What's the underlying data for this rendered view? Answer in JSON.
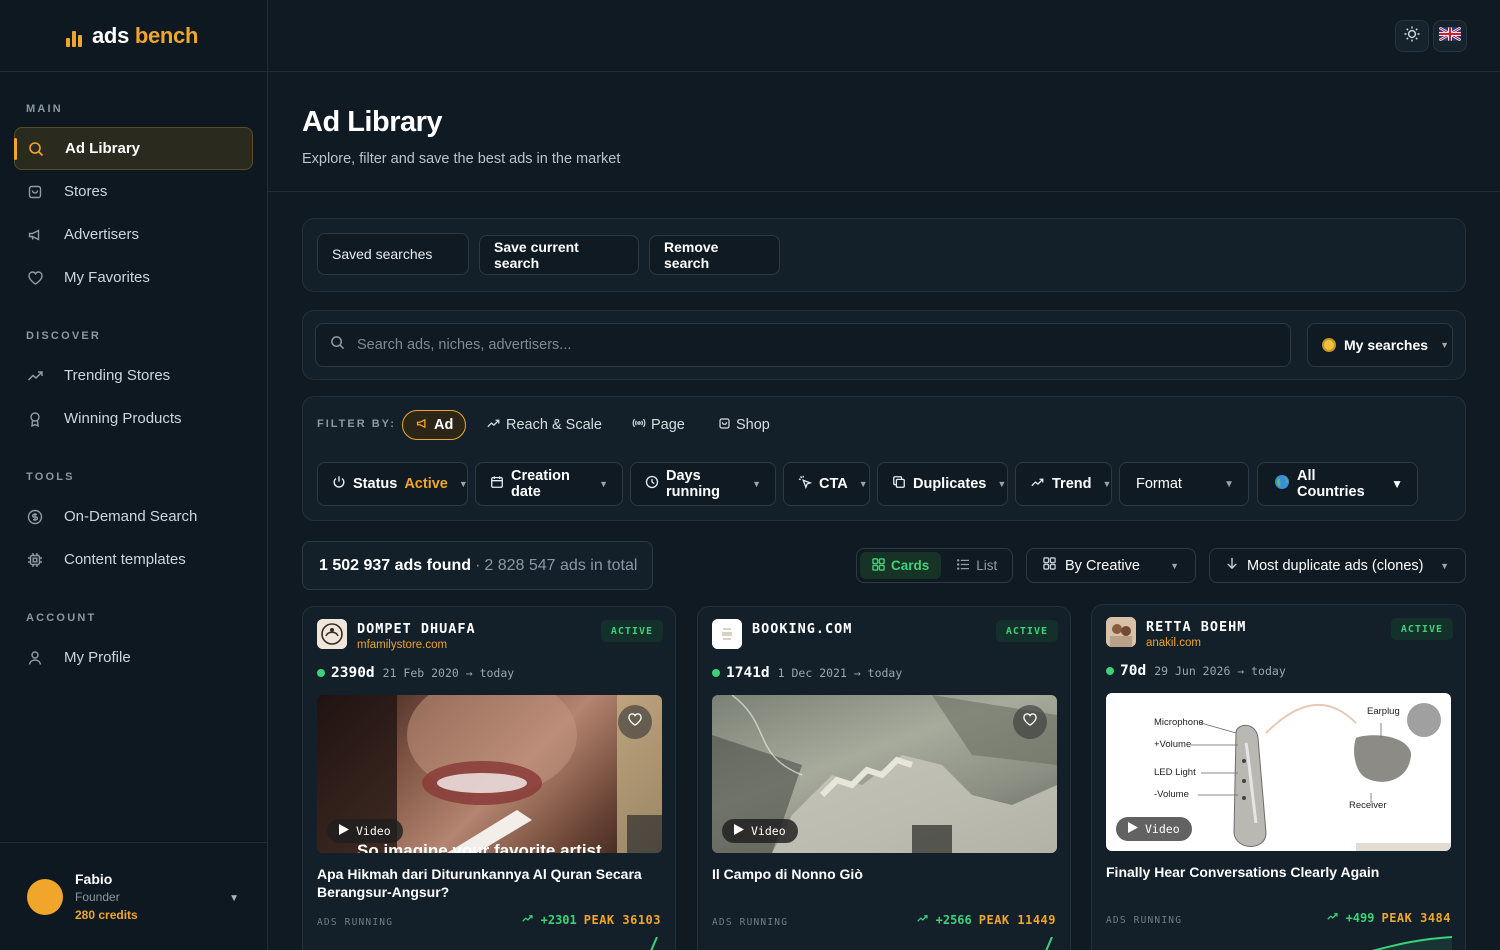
{
  "app": {
    "name_part1": "ads",
    "name_part2": "bench"
  },
  "sidebar": {
    "sections": [
      {
        "label": "MAIN",
        "items": [
          {
            "label": "Ad Library",
            "icon": "search-icon",
            "active": true
          },
          {
            "label": "Stores",
            "icon": "store-icon"
          },
          {
            "label": "Advertisers",
            "icon": "megaphone-icon"
          },
          {
            "label": "My Favorites",
            "icon": "heart-icon"
          }
        ]
      },
      {
        "label": "DISCOVER",
        "items": [
          {
            "label": "Trending Stores",
            "icon": "trending-icon"
          },
          {
            "label": "Winning Products",
            "icon": "award-icon"
          }
        ]
      },
      {
        "label": "TOOLS",
        "items": [
          {
            "label": "On-Demand Search",
            "icon": "dollar-icon"
          },
          {
            "label": "Content templates",
            "icon": "chip-icon"
          }
        ]
      },
      {
        "label": "ACCOUNT",
        "items": [
          {
            "label": "My Profile",
            "icon": "user-icon"
          }
        ]
      }
    ],
    "user": {
      "name": "Fabio",
      "role": "Founder",
      "credits": "280 credits"
    }
  },
  "topbar": {
    "theme_icon": "sun-icon",
    "language_icon": "uk-flag-icon"
  },
  "header": {
    "title": "Ad Library",
    "subtitle": "Explore, filter and save the best ads in the market"
  },
  "saved_searches": {
    "saved_label": "Saved searches",
    "save_current_label": "Save current search",
    "remove_label": "Remove search"
  },
  "search": {
    "placeholder": "Search ads, niches, advertisers...",
    "value": "",
    "my_searches_label": "My searches"
  },
  "filters": {
    "label": "FILTER BY:",
    "tabs": [
      "Ad",
      "Reach & Scale",
      "Page",
      "Shop"
    ],
    "active_tab": "Ad",
    "status_label": "Status",
    "status_value": "Active",
    "creation_date_label": "Creation date",
    "days_running_label": "Days running",
    "cta_label": "CTA",
    "duplicates_label": "Duplicates",
    "trend_label": "Trend",
    "format_label": "Format",
    "countries_label": "All Countries"
  },
  "results": {
    "found": "1 502 937 ads found",
    "separator": "·",
    "total": "2 828 547 ads in total",
    "view_cards": "Cards",
    "view_list": "List",
    "group_by": "By Creative",
    "sort_by": "Most duplicate ads (clones)"
  },
  "colors": {
    "accent": "#f0a52b",
    "active_green": "#3dd17a",
    "background": "#0f1a22",
    "panel": "#132029"
  },
  "cards": [
    {
      "name": "DOMPET DHUAFA",
      "domain": "mfamilystore.com",
      "status": "ACTIVE",
      "days": "2390d",
      "range": "21 Feb 2020 → today",
      "media": "Video",
      "caption": "So imagine your favorite artist",
      "title": "Apa Hikmah dari Diturunkannya Al Quran Secara Berangsur-Angsur?",
      "ads_running_label": "ADS RUNNING",
      "delta": "+2301",
      "peak": "PEAK 36103"
    },
    {
      "name": "BOOKING.COM",
      "domain": "",
      "status": "ACTIVE",
      "days": "1741d",
      "range": "1 Dec 2021 → today",
      "media": "Video",
      "title": "Il Campo di Nonno Giò",
      "ads_running_label": "ADS RUNNING",
      "delta": "+2566",
      "peak": "PEAK 11449"
    },
    {
      "name": "RETTA BOEHM",
      "domain": "anakil.com",
      "status": "ACTIVE",
      "days": "70d",
      "range": "29 Jun 2026 → today",
      "media": "Video",
      "labels": [
        "Microphone",
        "+Volume",
        "LED Light",
        "-Volume",
        "Earplug",
        "Receiver"
      ],
      "title": "Finally Hear Conversations Clearly Again",
      "ads_running_label": "ADS RUNNING",
      "delta": "+499",
      "peak": "PEAK 3484"
    }
  ]
}
